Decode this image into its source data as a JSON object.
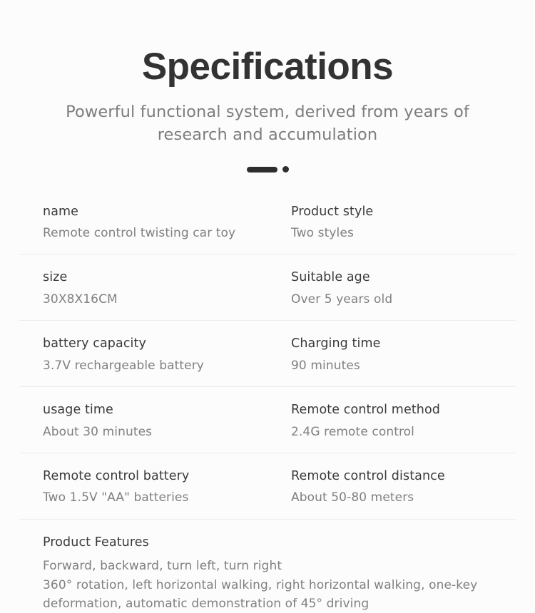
{
  "header": {
    "title": "Specifications",
    "subtitle": "Powerful functional system, derived from years of research and accumulation"
  },
  "ornament": {
    "bar_name": "divider-bar",
    "dot_name": "divider-dot",
    "color": "#2e2e2e"
  },
  "colors": {
    "background": "#fcfcfc",
    "title": "#333333",
    "subtitle": "#7d7d7d",
    "label": "#3a3a3a",
    "value": "#808080",
    "separator": "#ececec"
  },
  "spec_table": {
    "rows": [
      {
        "left": {
          "label": "name",
          "value": "Remote control twisting car toy"
        },
        "right": {
          "label": "Product style",
          "value": "Two styles"
        }
      },
      {
        "left": {
          "label": "size",
          "value": "30X8X16CM"
        },
        "right": {
          "label": "Suitable age",
          "value": "Over 5 years old"
        }
      },
      {
        "left": {
          "label": "battery capacity",
          "value": "3.7V rechargeable battery"
        },
        "right": {
          "label": "Charging time",
          "value": "90 minutes"
        }
      },
      {
        "left": {
          "label": "usage time",
          "value": "About 30 minutes"
        },
        "right": {
          "label": "Remote control method",
          "value": "2.4G remote control"
        }
      },
      {
        "left": {
          "label": "Remote control battery",
          "value": "Two 1.5V \"AA\" batteries"
        },
        "right": {
          "label": "Remote control distance",
          "value": "About 50-80 meters"
        }
      }
    ]
  },
  "features": {
    "title": "Product Features",
    "lines": [
      "Forward, backward, turn left, turn right",
      "360° rotation, left horizontal walking, right horizontal walking, one-key",
      "deformation, automatic demonstration of 45° driving"
    ]
  }
}
